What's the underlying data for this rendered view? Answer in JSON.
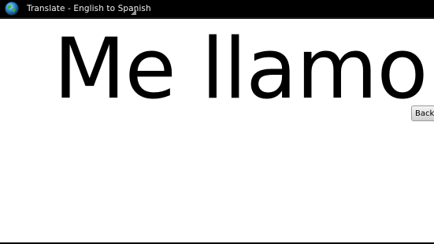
{
  "titlebar": {
    "icon": "globe-icon",
    "title": "Translate - English to Spanish"
  },
  "main": {
    "translation_text": "Me llamo",
    "back_button_label": "Back"
  },
  "colors": {
    "titlebar_bg": "#000000",
    "content_bg": "#ffffff",
    "text": "#000000"
  }
}
